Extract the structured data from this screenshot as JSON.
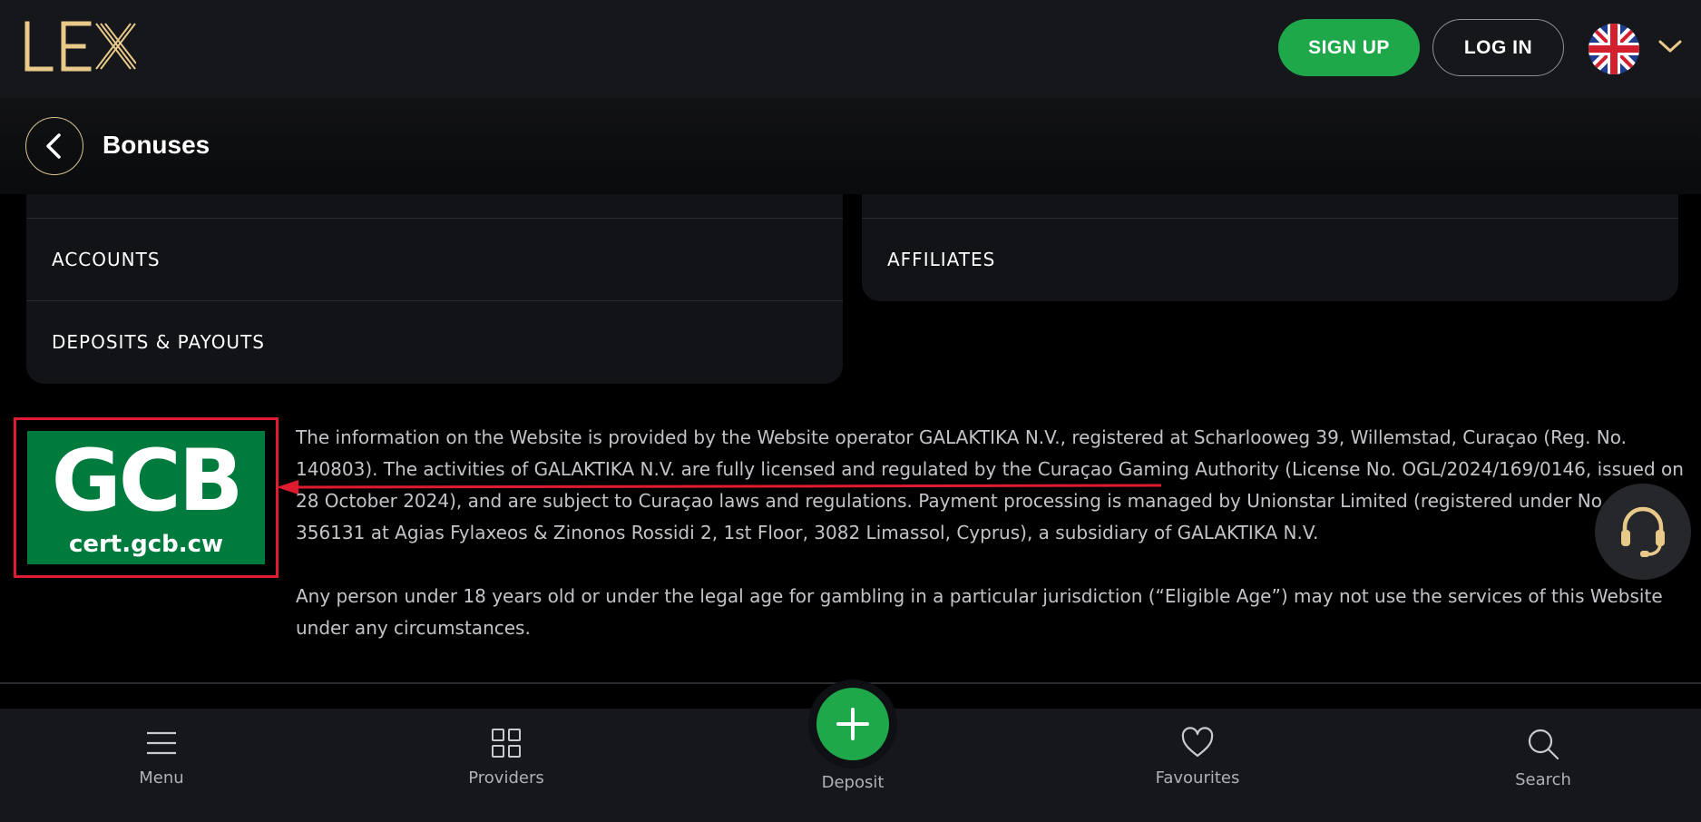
{
  "header": {
    "logo_text": "LEX",
    "signup_label": "SIGN UP",
    "login_label": "LOG IN",
    "language_icon": "uk-flag-icon"
  },
  "subheader": {
    "title": "Bonuses"
  },
  "cards": {
    "left": [
      "ACCOUNTS",
      "DEPOSITS & PAYOUTS"
    ],
    "right": [
      "AFFILIATES"
    ]
  },
  "license": {
    "badge_big": "GCB",
    "badge_small": "cert.gcb.cw",
    "paragraph1_highlight": "The activities of GALAKTIKA N.V. are fully licensed and regulated by the Curaçao Gaming Authority",
    "paragraph1_start": "The information on the Website is provided by the Website operator GALAKTIKA N.V., registered at Scharlooweg 39, Willemstad, Curaçao (Reg. No. 140803).",
    "paragraph1_end": "(License No. OGL/2024/169/0146, issued on 28 October 2024), and are subject to Curaçao laws and regulations. Payment processing is managed by Unionstar Limited (registered under No. HE 356131 at Agias Fylaxeos & Zinonos Rossidi 2, 1st Floor, 3082 Limassol, Cyprus), a subsidiary of GALAKTIKA N.V.",
    "paragraph2": "Any person under 18 years old or under the legal age for gambling in a particular jurisdiction (“Eligible Age”) may not use the services of this Website under any circumstances."
  },
  "colors": {
    "accent_green": "#1fa84a",
    "logo_gold": "#e8c98a",
    "highlight_red": "#e01b2f",
    "badge_green": "#007a3d"
  },
  "bottom_nav": {
    "menu": "Menu",
    "providers": "Providers",
    "deposit": "Deposit",
    "favourites": "Favourites",
    "search": "Search"
  }
}
